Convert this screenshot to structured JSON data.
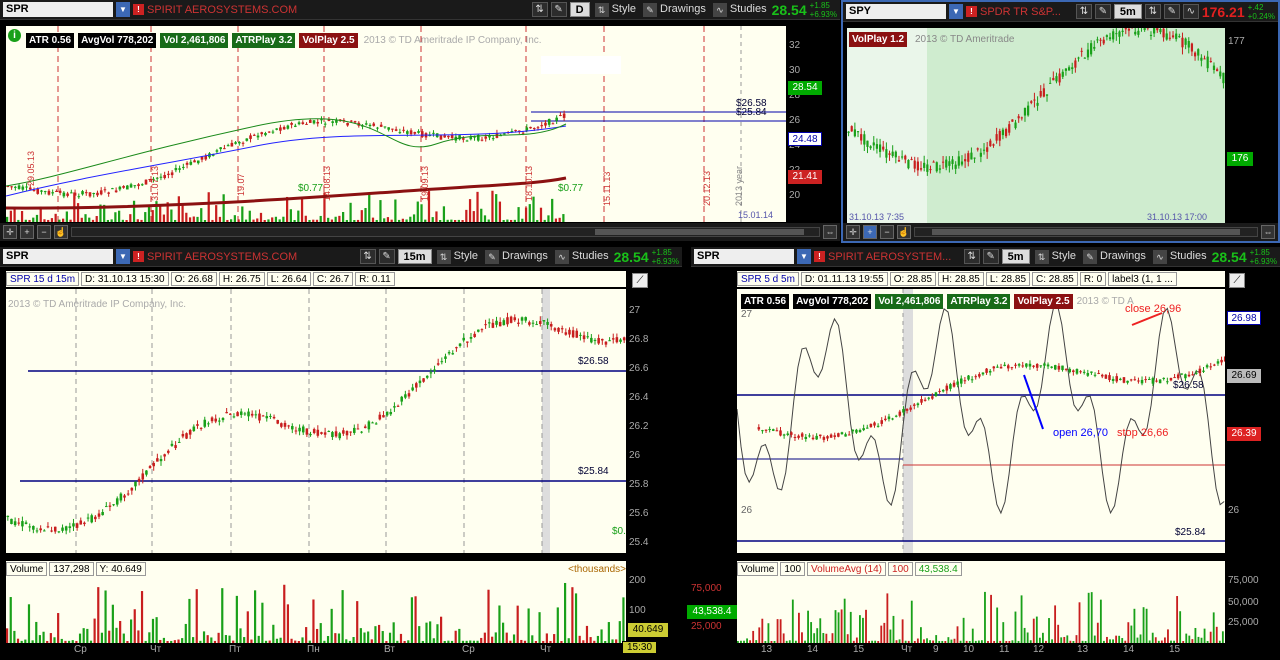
{
  "colors": {
    "up": "#19a019",
    "down": "#c81e1e",
    "accent": "#3c68b4",
    "navy": "#000080",
    "chartbg": "#fffff0"
  },
  "p1": {
    "symbol": "SPR",
    "company": "SPIRIT AEROSYSTEMS.COM",
    "timeframe": "D",
    "style": "Style",
    "drawings": "Drawings",
    "studies": "Studies",
    "price": "28.54",
    "chg": "+1.85",
    "chgpct": "+6.93%",
    "studyAtr": "ATR 0.56",
    "studyAvg": "AvgVol 778,202",
    "studyVol": "Vol 2,461,806",
    "studyAtrPlay": "ATRPlay 3.2",
    "studyVolPlay": "VolPlay 2.5",
    "copyright": "2013 © TD Ameritrade IP Company, Inc.",
    "lvl1": "$26.58",
    "lvl2": "$25.84",
    "div1": "$0.77",
    "div2": "$0.77",
    "yTicks": [
      "32",
      "30",
      "28",
      "26",
      "24",
      "22",
      "20"
    ],
    "badgeTop": "28.54",
    "badgeMid": "24.48",
    "badgeLow": "21.41",
    "xLabels": [
      "29.05.13",
      "31.07.13",
      "19.07",
      "14.08.13",
      "19.09.13",
      "18.10.13",
      "15.11.13",
      "20.12.13",
      "2013 year"
    ],
    "lastDate": "15.01.14"
  },
  "p2": {
    "symbol": "SPY",
    "company": "SPDR TR S&P...",
    "timeframe": "5m",
    "price": "176.21",
    "chg": "+.42",
    "chgpct": "+0.24%",
    "study": "VolPlay 1.2",
    "copyright": "2013 © TD Ameritrade",
    "yTop": "177",
    "badge": "176",
    "startDate": "31.10.13 7:35",
    "endDate": "31.10.13 17:00"
  },
  "p3": {
    "symbol": "SPR",
    "company": "SPIRIT AEROSYSTEMS.COM",
    "timeframe": "15m",
    "style": "Style",
    "drawings": "Drawings",
    "studies": "Studies",
    "price": "28.54",
    "chg": "+1.85",
    "chgpct": "+6.93%",
    "infoTitle": "SPR 15 d 15m",
    "infoD": "D: 31.10.13 15:30",
    "infoO": "O: 26.68",
    "infoH": "H: 26.75",
    "infoL": "L: 26.64",
    "infoC": "C: 26.7",
    "infoR": "R: 0.11",
    "copyright": "2013 © TD Ameritrade IP Company, Inc.",
    "lvl1": "$26.58",
    "lvl2": "$25.84",
    "div": "$0.",
    "yTicks": [
      "27",
      "26.8",
      "26.6",
      "26.4",
      "26.2",
      "26",
      "25.8",
      "25.6",
      "25.4"
    ],
    "volLabel": "Volume",
    "volVal": "137,298",
    "volY": "Y: 40.649",
    "volUnits": "<thousands>",
    "volTicks": [
      "200",
      "100"
    ],
    "volBadge": "40.649",
    "timeBadge": "15:30",
    "xLabels": [
      "Ср",
      "Чт",
      "Пт",
      "Пн",
      "Вт",
      "Ср",
      "Чт"
    ]
  },
  "p4": {
    "symbol": "SPR",
    "company": "SPIRIT AEROSYSTEM...",
    "timeframe": "5m",
    "style": "Style",
    "drawings": "Drawings",
    "studies": "Studies",
    "price": "28.54",
    "chg": "+1.85",
    "chgpct": "+6.93%",
    "infoTitle": "SPR 5 d 5m",
    "infoD": "D: 01.11.13 19:55",
    "infoO": "O: 28.85",
    "infoH": "H: 28.85",
    "infoL": "L: 28.85",
    "infoC": "C: 28.85",
    "infoR": "R: 0",
    "infoLabel": "label3 (1, 1 ...",
    "studyAtr": "ATR 0.56",
    "studyAvg": "AvgVol 778,202",
    "studyVol": "Vol 2,461,806",
    "studyAtrPlay": "ATRPlay 3.2",
    "studyVolPlay": "VolPlay 2.5",
    "copyright": "2013 © TD A",
    "closeNote": "close 26,96",
    "openNote": "open 26,70",
    "stopNote": "stop 26,66",
    "lvl1": "$26.58",
    "lvl2": "$25.84",
    "yTop": "27",
    "yLow": "26",
    "yRight": "26",
    "badgeTop": "26.98",
    "badgeMid": "26.69",
    "badgeLow": "26.39",
    "volLabel": "Volume",
    "volVal": "100",
    "volAvgLabel": "VolumeAvg (14)",
    "volAvgVal": "100",
    "volExtra": "43,538.4",
    "volLeftTicks": [
      "75,000",
      "50,000",
      "25,000"
    ],
    "volRightTicks": [
      "75,000",
      "50,000",
      "25,000"
    ],
    "volBadge": "43,538.4",
    "xLabels": [
      "13",
      "14",
      "15",
      "Чт",
      "9",
      "10",
      "11",
      "12",
      "13",
      "14",
      "15"
    ]
  }
}
